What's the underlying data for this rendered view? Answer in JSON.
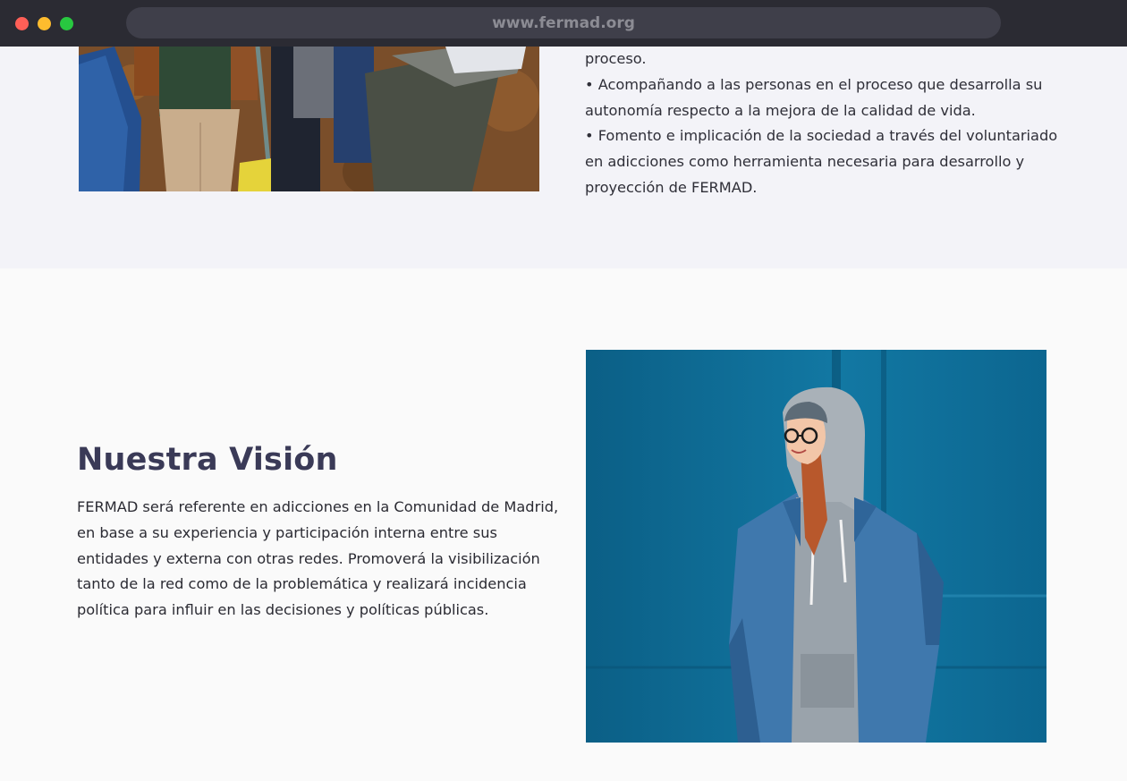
{
  "browser": {
    "url": "www.fermad.org"
  },
  "mission": {
    "lines": [
      "proceso.",
      "• Acompañando a las personas en el proceso que desarrolla su",
      "autonomía respecto a la mejora de la calidad de vida.",
      "• Fomento e implicación de la sociedad a través del voluntariado",
      "en adicciones como herramienta necesaria para desarrollo y",
      "proyección de FERMAD."
    ]
  },
  "vision": {
    "title": "Nuestra Visión",
    "lines": [
      "FERMAD será referente en adicciones en la Comunidad de Madrid,",
      "en base a su experiencia y participación interna entre sus",
      "entidades y externa con otras redes. Promoverá la visibilización",
      "tanto de la red como de la problemática y realizará incidencia",
      "política para influir en las decisiones y políticas públicas."
    ]
  },
  "colors": {
    "chrome": "#2b2b33",
    "title": "#3a3a57",
    "section_top_bg": "#f3f3f8",
    "section_bottom_bg": "#fafafa",
    "photo_wall": "#0f6d93"
  }
}
